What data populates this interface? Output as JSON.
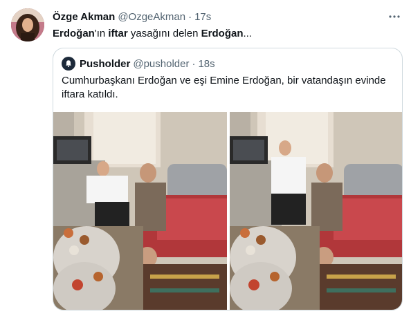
{
  "tweet": {
    "display_name": "Özge Akman",
    "handle": "@OzgeAkman",
    "separator": "·",
    "time": "17s",
    "text_parts": {
      "p1": "Erdoğan",
      "p2": "'ın ",
      "p3": "iftar",
      "p4": " yasağını delen ",
      "p5": "Erdoğan",
      "p6": "..."
    },
    "more_icon": "more-horizontal-icon"
  },
  "quote": {
    "display_name": "Pusholder",
    "handle": "@pusholder",
    "separator": "·",
    "time": "18s",
    "text": "Cumhurbaşkanı Erdoğan ve eşi Emine Erdoğan, bir vatandaşın evinde iftara katıldı.",
    "photos": [
      "photo-1",
      "photo-2"
    ]
  },
  "colors": {
    "text": "#0f1419",
    "secondary": "#536471",
    "border": "#cfd9de"
  }
}
